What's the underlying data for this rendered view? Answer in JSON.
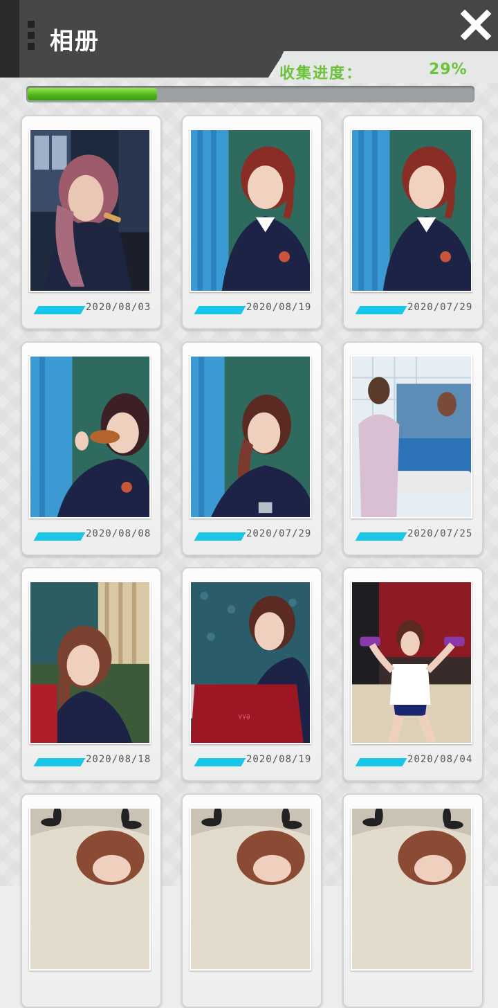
{
  "header": {
    "title": "相册",
    "close_icon": "close-icon"
  },
  "progress": {
    "label": "收集进度：",
    "value_text": "29%",
    "fraction": 0.29
  },
  "colors": {
    "accent_green": "#6cc23a",
    "accent_cyan": "#19c6e8",
    "header_dark": "#474747"
  },
  "photos": [
    {
      "date": "2020/08/03",
      "scene": "dorm-window-eating"
    },
    {
      "date": "2020/08/19",
      "scene": "classroom-curtain"
    },
    {
      "date": "2020/07/29",
      "scene": "classroom-curtain"
    },
    {
      "date": "2020/08/08",
      "scene": "classroom-eating-drumstick"
    },
    {
      "date": "2020/07/29",
      "scene": "classroom-study"
    },
    {
      "date": "2020/07/25",
      "scene": "bathroom-brushing-teeth"
    },
    {
      "date": "2020/08/18",
      "scene": "bedroom-red-chair"
    },
    {
      "date": "2020/08/19",
      "scene": "laptop-red"
    },
    {
      "date": "2020/08/04",
      "scene": "exercise-dumbbells"
    },
    {
      "date": "",
      "scene": "sleeping-pillow"
    },
    {
      "date": "",
      "scene": "sleeping-pillow"
    },
    {
      "date": "",
      "scene": "sleeping-pillow"
    }
  ]
}
